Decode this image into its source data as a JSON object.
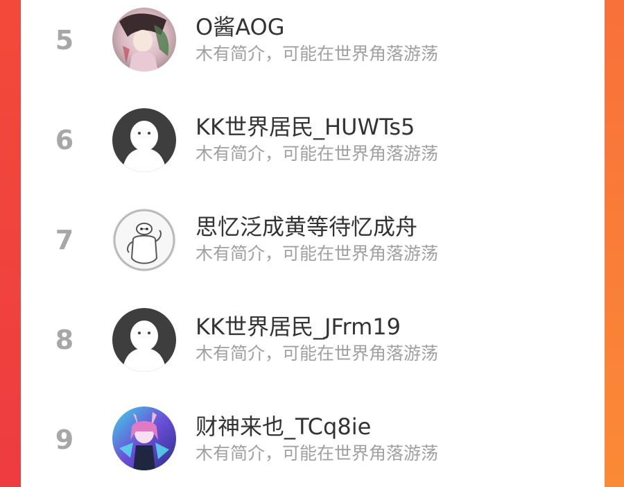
{
  "ranking": {
    "items": [
      {
        "rank": "5",
        "name": "O酱AOG",
        "bio": "木有简介，可能在世界角落游荡",
        "avatar_icon": "anime-girl-avatar-icon"
      },
      {
        "rank": "6",
        "name": "KK世界居民_HUWTs5",
        "bio": "木有简介，可能在世界角落游荡",
        "avatar_icon": "default-user-avatar-icon"
      },
      {
        "rank": "7",
        "name": "思忆泛成黄等待忆成舟",
        "bio": "木有简介，可能在世界角落游荡",
        "avatar_icon": "baymax-avatar-icon"
      },
      {
        "rank": "8",
        "name": "KK世界居民_JFrm19",
        "bio": "木有简介，可能在世界角落游荡",
        "avatar_icon": "default-user-avatar-icon"
      },
      {
        "rank": "9",
        "name": "财神来也_TCq8ie",
        "bio": "木有简介，可能在世界角落游荡",
        "avatar_icon": "anime-character-avatar-icon"
      }
    ]
  },
  "colors": {
    "left_edge": "#f0473c",
    "right_edge": "#f98a35",
    "rank_text": "#a7a7a7",
    "name_text": "#333333",
    "bio_text": "#a0a0a0"
  }
}
